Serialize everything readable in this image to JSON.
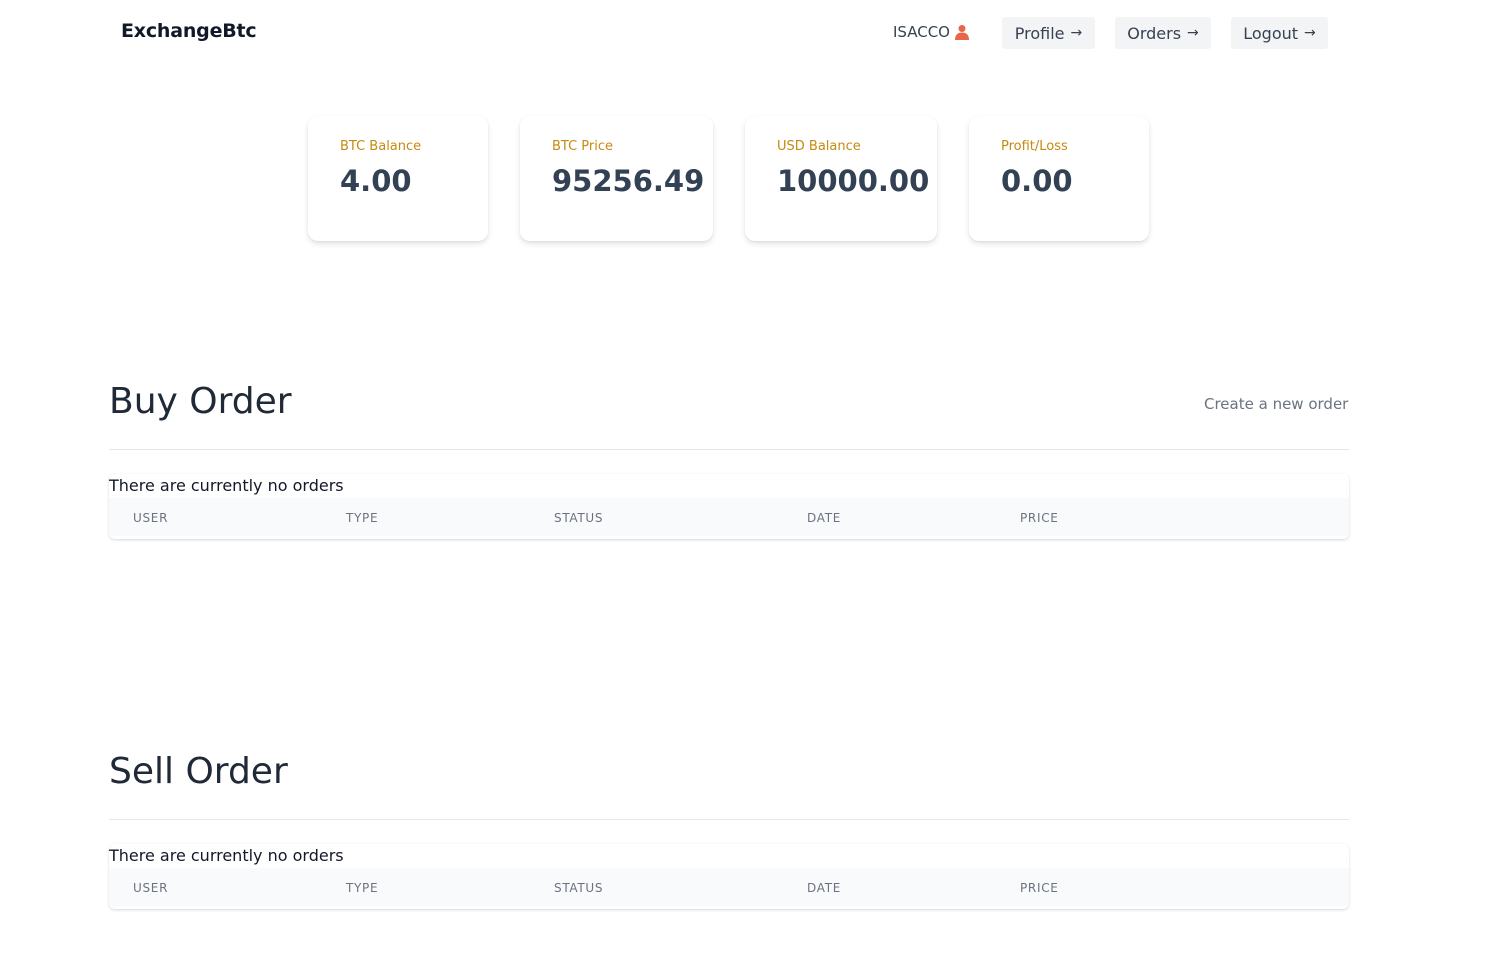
{
  "nav": {
    "brand": "ExchangeBtc",
    "username": "ISACCO",
    "user_icon": "user-icon",
    "buttons": [
      {
        "label": "Profile",
        "icon": "arrow-right-icon"
      },
      {
        "label": "Orders",
        "icon": "arrow-right-icon"
      },
      {
        "label": "Logout",
        "icon": "arrow-right-icon"
      }
    ]
  },
  "stats": [
    {
      "label": "BTC Balance",
      "value": "4.00"
    },
    {
      "label": "BTC Price",
      "value": "95256.49"
    },
    {
      "label": "USD Balance",
      "value": "10000.00"
    },
    {
      "label": "Profit/Loss",
      "value": "0.00"
    }
  ],
  "buy": {
    "title": "Buy Order",
    "create_link": "Create a new order",
    "empty_message": "There are currently no orders",
    "columns": [
      "USER",
      "TYPE",
      "STATUS",
      "DATE",
      "PRICE"
    ]
  },
  "sell": {
    "title": "Sell Order",
    "empty_message": "There are currently no orders",
    "columns": [
      "USER",
      "TYPE",
      "STATUS",
      "DATE",
      "PRICE"
    ]
  },
  "colors": {
    "accent_label": "#c58a0f",
    "user_icon": "#e8654a",
    "button_bg": "#f3f4f6"
  }
}
